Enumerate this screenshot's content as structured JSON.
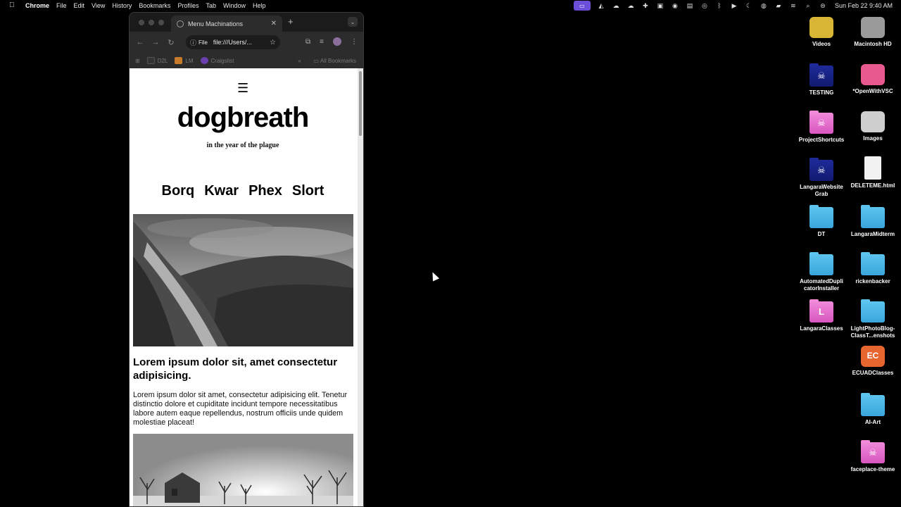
{
  "menubar": {
    "app_name": "Chrome",
    "menus": [
      "File",
      "Edit",
      "View",
      "History",
      "Bookmarks",
      "Profiles",
      "Tab",
      "Window",
      "Help"
    ],
    "clock": "Sun Feb 22  9:40 AM"
  },
  "browser": {
    "tab_title": "Menu Machinations",
    "omnibox_chip": "File",
    "url": "file:///Users/...",
    "bookmarks": [
      "D2L",
      "LM",
      "Craigslist"
    ],
    "all_bookmarks": "All Bookmarks",
    "overflow": "»"
  },
  "page": {
    "menu_icon": "☰",
    "site_title": "dogbreath",
    "tagline": "in the year of the plague",
    "nav": [
      "Borq",
      "Kwar",
      "Phex",
      "Slort"
    ],
    "article_title": "Lorem ipsum dolor sit, amet consectetur adipisicing.",
    "article_body": "Lorem ipsum dolor sit amet, consectetur adipisicing elit. Tenetur distinctio dolore et cupiditate incidunt tempore necessitatibus labore autem eaque repellendus, nostrum officiis unde quidem molestiae placeat!"
  },
  "desktop": {
    "icons": [
      {
        "label": "Videos",
        "icon": "app-icon"
      },
      {
        "label": "Macintosh HD",
        "icon": "drive-icon"
      },
      {
        "label": "TESTING",
        "icon": "folder-icon"
      },
      {
        "label": "*OpenWithVSC",
        "icon": "app-icon"
      },
      {
        "label": "ProjectShortcuts",
        "icon": "folder-icon"
      },
      {
        "label": "Images",
        "icon": "image-icon"
      },
      {
        "label": "LangaraWebsite Grab",
        "icon": "folder-icon"
      },
      {
        "label": "DELETEME.html",
        "icon": "html-file-icon"
      },
      {
        "label": "DT",
        "icon": "folder-icon"
      },
      {
        "label": "LangaraMidterm",
        "icon": "folder-icon"
      },
      {
        "label": "AutomatedDupli catorInstaller",
        "icon": "folder-icon"
      },
      {
        "label": "rickenbacker",
        "icon": "folder-icon"
      },
      {
        "label": "LangaraClasses",
        "icon": "folder-icon"
      },
      {
        "label": "LightPhotoBlog-ClassT...enshots",
        "icon": "folder-icon"
      },
      {
        "label": "ECUADClasses",
        "icon": "app-icon"
      },
      {
        "label": "AI-Art",
        "icon": "folder-icon"
      },
      {
        "label": "faceplace-theme",
        "icon": "folder-icon"
      }
    ]
  }
}
